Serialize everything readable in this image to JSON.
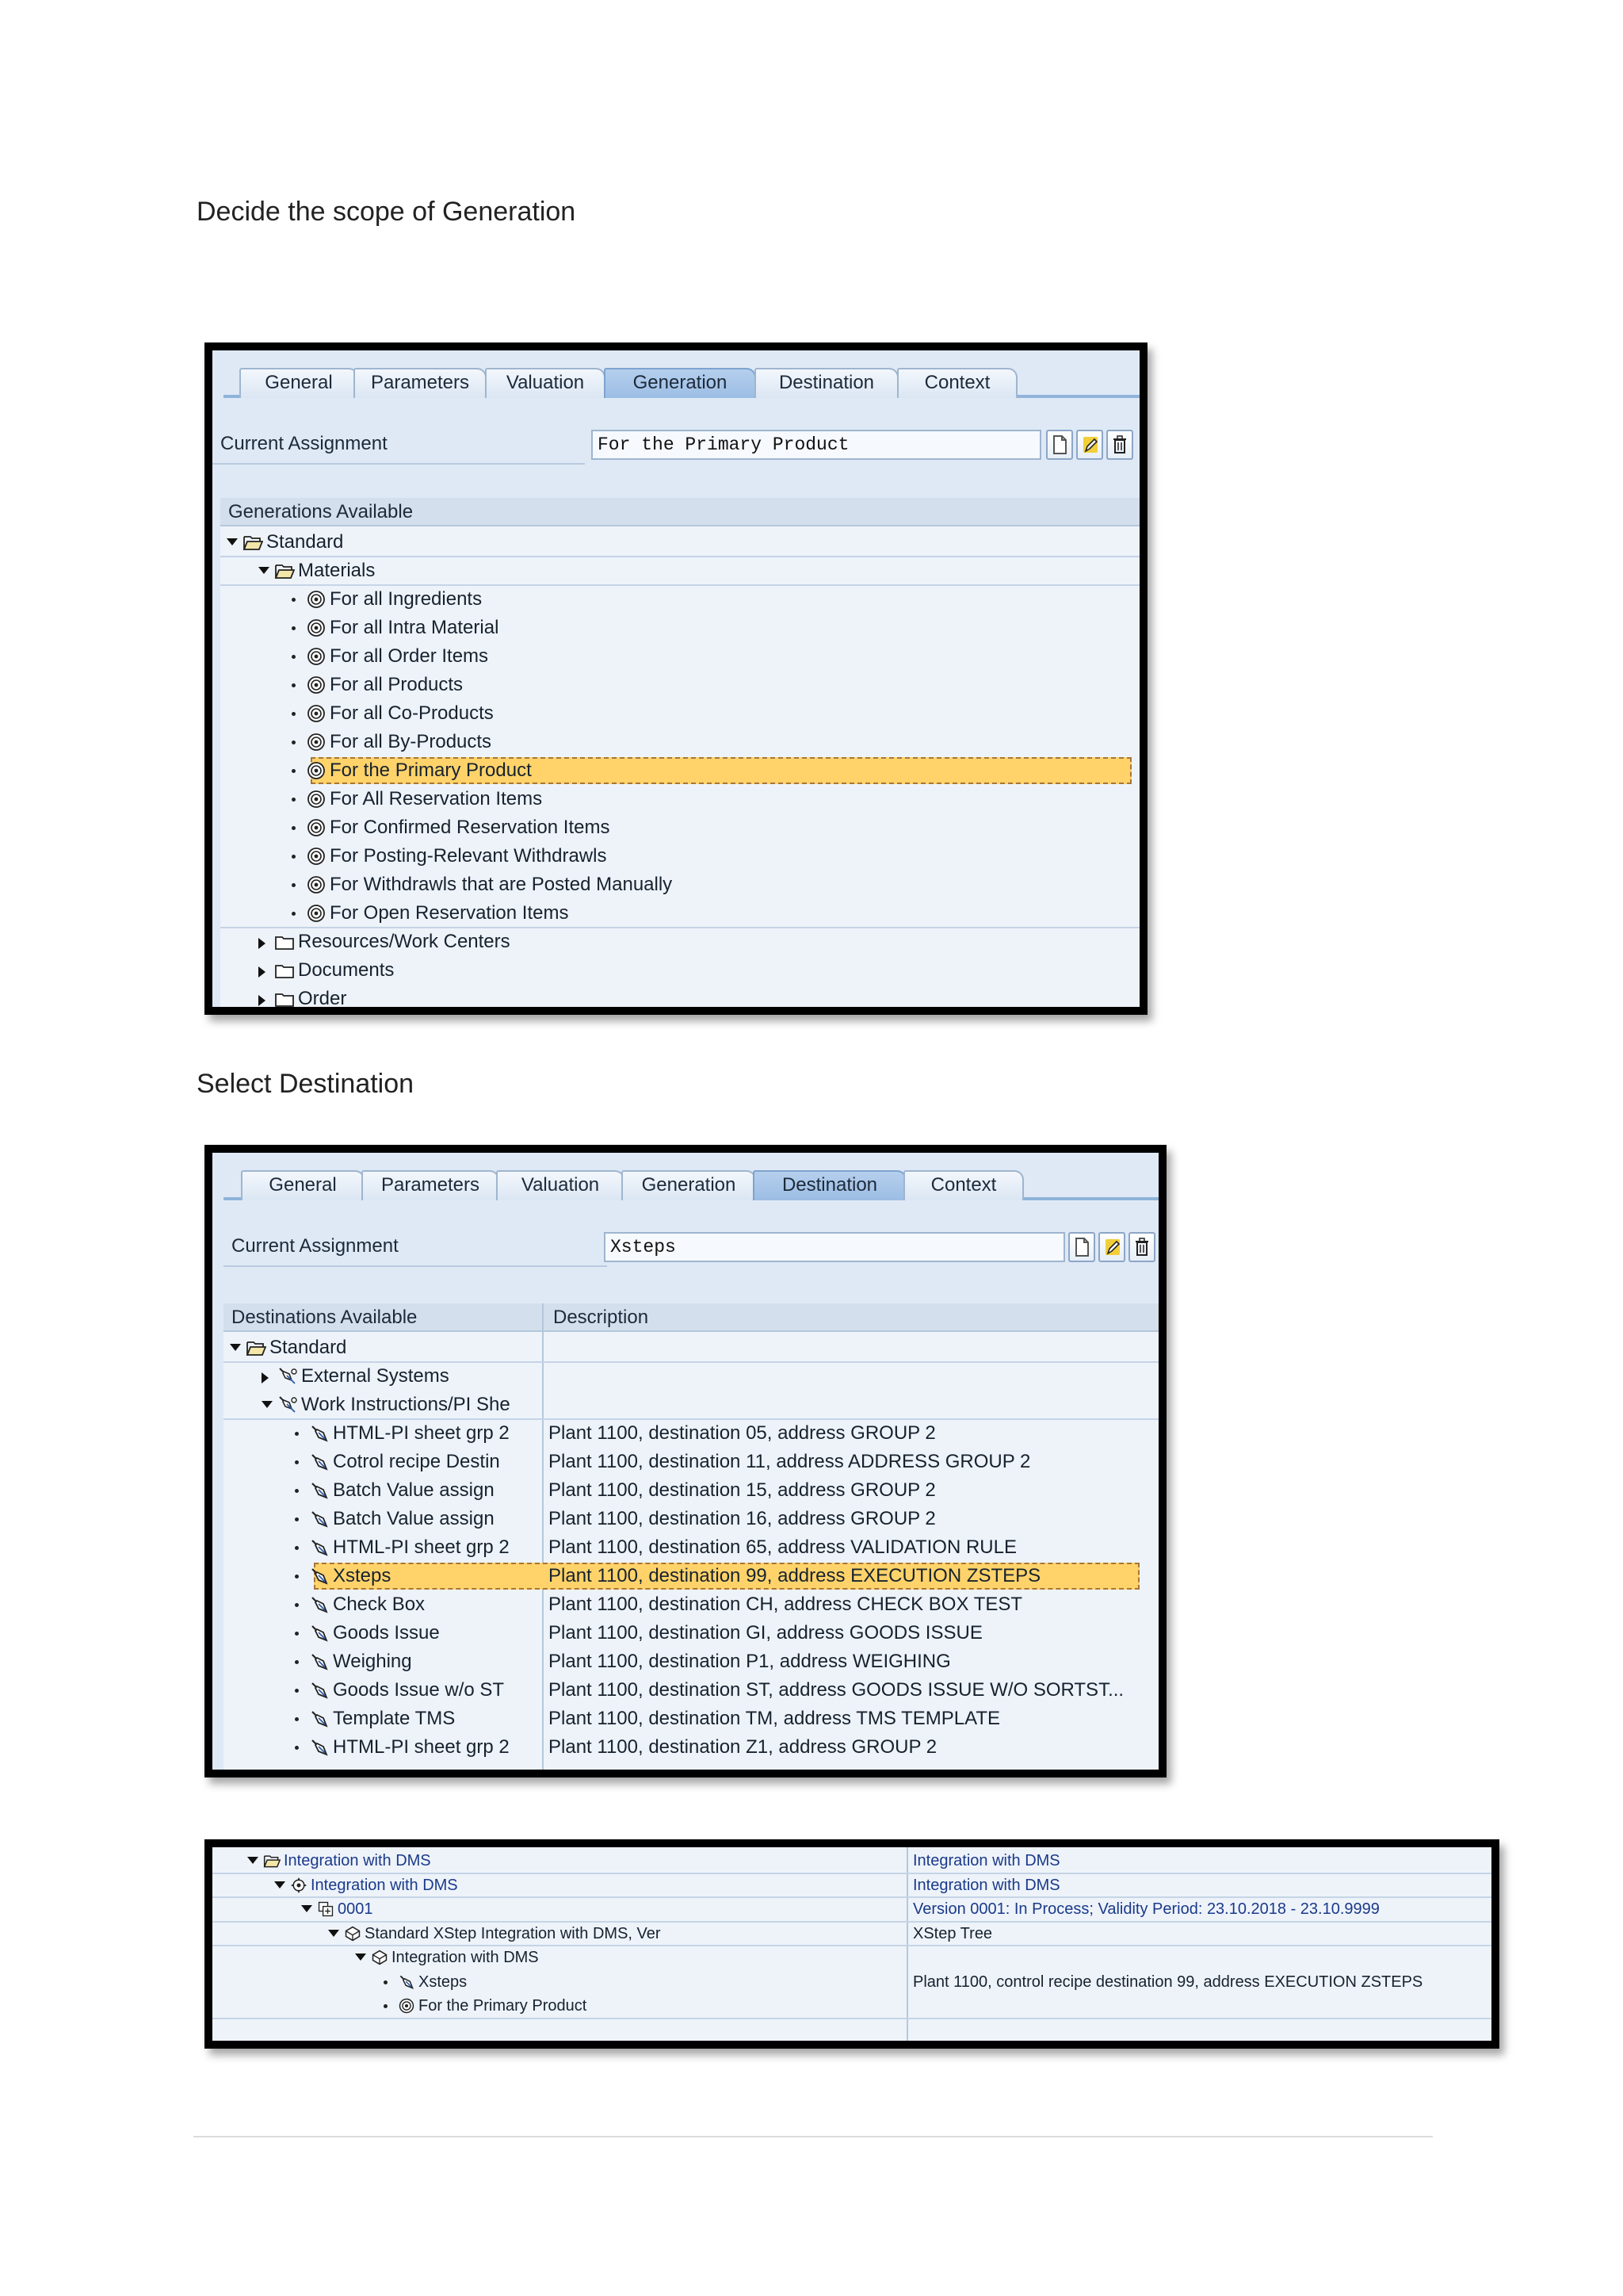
{
  "headings": {
    "h1": "Decide the scope of Generation",
    "h2": "Select Destination"
  },
  "screen1": {
    "tabs": [
      "General",
      "Parameters",
      "Valuation",
      "Generation",
      "Destination",
      "Context"
    ],
    "active_tab": "Generation",
    "current_assignment_label": "Current Assignment",
    "current_assignment_value": "For the Primary Product",
    "tree_header": "Generations Available",
    "nodes": [
      {
        "label": "Standard",
        "icon": "folder-open-icon",
        "toggle": "open"
      },
      {
        "label": "Materials",
        "icon": "folder-open-icon",
        "toggle": "open"
      },
      {
        "label": "For all Ingredients",
        "icon": "generation-icon"
      },
      {
        "label": "For all Intra Material",
        "icon": "generation-icon"
      },
      {
        "label": "For all Order Items",
        "icon": "generation-icon"
      },
      {
        "label": "For all Products",
        "icon": "generation-icon"
      },
      {
        "label": "For all Co-Products",
        "icon": "generation-icon"
      },
      {
        "label": "For all By-Products",
        "icon": "generation-icon"
      },
      {
        "label": "For the Primary Product",
        "icon": "generation-icon",
        "selected": true
      },
      {
        "label": "For All Reservation Items",
        "icon": "generation-icon"
      },
      {
        "label": "For Confirmed Reservation Items",
        "icon": "generation-icon"
      },
      {
        "label": "For Posting-Relevant Withdrawls",
        "icon": "generation-icon"
      },
      {
        "label": "For Withdrawls that are Posted Manually",
        "icon": "generation-icon"
      },
      {
        "label": "For Open Reservation Items",
        "icon": "generation-icon"
      },
      {
        "label": "Resources/Work Centers",
        "icon": "folder-icon",
        "toggle": "closed"
      },
      {
        "label": "Documents",
        "icon": "folder-icon",
        "toggle": "closed"
      },
      {
        "label": "Order",
        "icon": "folder-icon",
        "toggle": "closed"
      }
    ]
  },
  "screen2": {
    "tabs": [
      "General",
      "Parameters",
      "Valuation",
      "Generation",
      "Destination",
      "Context"
    ],
    "active_tab": "Destination",
    "current_assignment_label": "Current Assignment",
    "current_assignment_value": "Xsteps",
    "tree_header": "Destinations Available",
    "desc_header": "Description",
    "nodes": [
      {
        "label": "Standard",
        "icon": "folder-open-icon",
        "toggle": "open",
        "desc": ""
      },
      {
        "label": "External Systems",
        "icon": "destination-group-icon",
        "toggle": "closed",
        "desc": ""
      },
      {
        "label": "Work Instructions/PI She",
        "icon": "destination-group-icon",
        "toggle": "open",
        "desc": ""
      },
      {
        "label": "HTML-PI sheet grp 2",
        "icon": "destination-icon",
        "desc": "Plant 1100, destination 05, address GROUP 2"
      },
      {
        "label": "Cotrol recipe Destin",
        "icon": "destination-icon",
        "desc": "Plant 1100, destination 11, address ADDRESS GROUP 2"
      },
      {
        "label": "Batch Value assign",
        "icon": "destination-icon",
        "desc": "Plant 1100, destination 15, address GROUP 2"
      },
      {
        "label": "Batch Value assign",
        "icon": "destination-icon",
        "desc": "Plant 1100, destination 16, address GROUP 2"
      },
      {
        "label": "HTML-PI sheet grp 2",
        "icon": "destination-icon",
        "desc": "Plant 1100, destination 65, address VALIDATION RULE"
      },
      {
        "label": "Xsteps",
        "icon": "destination-icon",
        "desc": "Plant 1100, destination 99, address EXECUTION ZSTEPS",
        "selected": true
      },
      {
        "label": "Check Box",
        "icon": "destination-icon",
        "desc": "Plant 1100, destination CH, address CHECK BOX TEST"
      },
      {
        "label": "Goods Issue",
        "icon": "destination-icon",
        "desc": "Plant 1100, destination GI, address GOODS ISSUE"
      },
      {
        "label": "Weighing",
        "icon": "destination-icon",
        "desc": "Plant 1100, destination P1, address WEIGHING"
      },
      {
        "label": "Goods Issue w/o ST",
        "icon": "destination-icon",
        "desc": "Plant 1100, destination ST, address GOODS ISSUE W/O SORTST..."
      },
      {
        "label": "Template TMS",
        "icon": "destination-icon",
        "desc": "Plant 1100, destination TM, address TMS TEMPLATE"
      },
      {
        "label": "HTML-PI sheet grp 2",
        "icon": "destination-icon",
        "desc": "Plant 1100, destination Z1, address GROUP 2"
      }
    ]
  },
  "screen3": {
    "nodes": [
      {
        "label": "Integration with DMS",
        "icon": "folder-open-icon",
        "toggle": "open",
        "desc": "Integration with DMS",
        "link": true
      },
      {
        "label": "Integration with DMS",
        "icon": "gear-group-icon",
        "toggle": "open",
        "desc": "Integration with DMS",
        "link": true
      },
      {
        "label": "0001",
        "icon": "version-icon",
        "toggle": "open",
        "desc": "Version 0001: In Process; Validity Period: 23.10.2018 - 23.10.9999",
        "link": true
      },
      {
        "label": "Standard XStep Integration with DMS, Ver",
        "icon": "xstep-icon",
        "toggle": "open",
        "desc": "XStep Tree"
      },
      {
        "label": "Integration with DMS",
        "icon": "xstep-icon",
        "toggle": "open",
        "desc": ""
      },
      {
        "label": "Xsteps",
        "icon": "destination-icon",
        "desc": "Plant 1100, control recipe destination 99, address EXECUTION ZSTEPS"
      },
      {
        "label": "For the Primary Product",
        "icon": "generation-icon",
        "desc": ""
      }
    ]
  },
  "colors": {
    "panel_bg": "#dfe9f5",
    "tree_bg": "#eef3fa",
    "selection": "#ffd36a",
    "active_tab": "#9cbde4",
    "link_text": "#1a3a8a"
  }
}
